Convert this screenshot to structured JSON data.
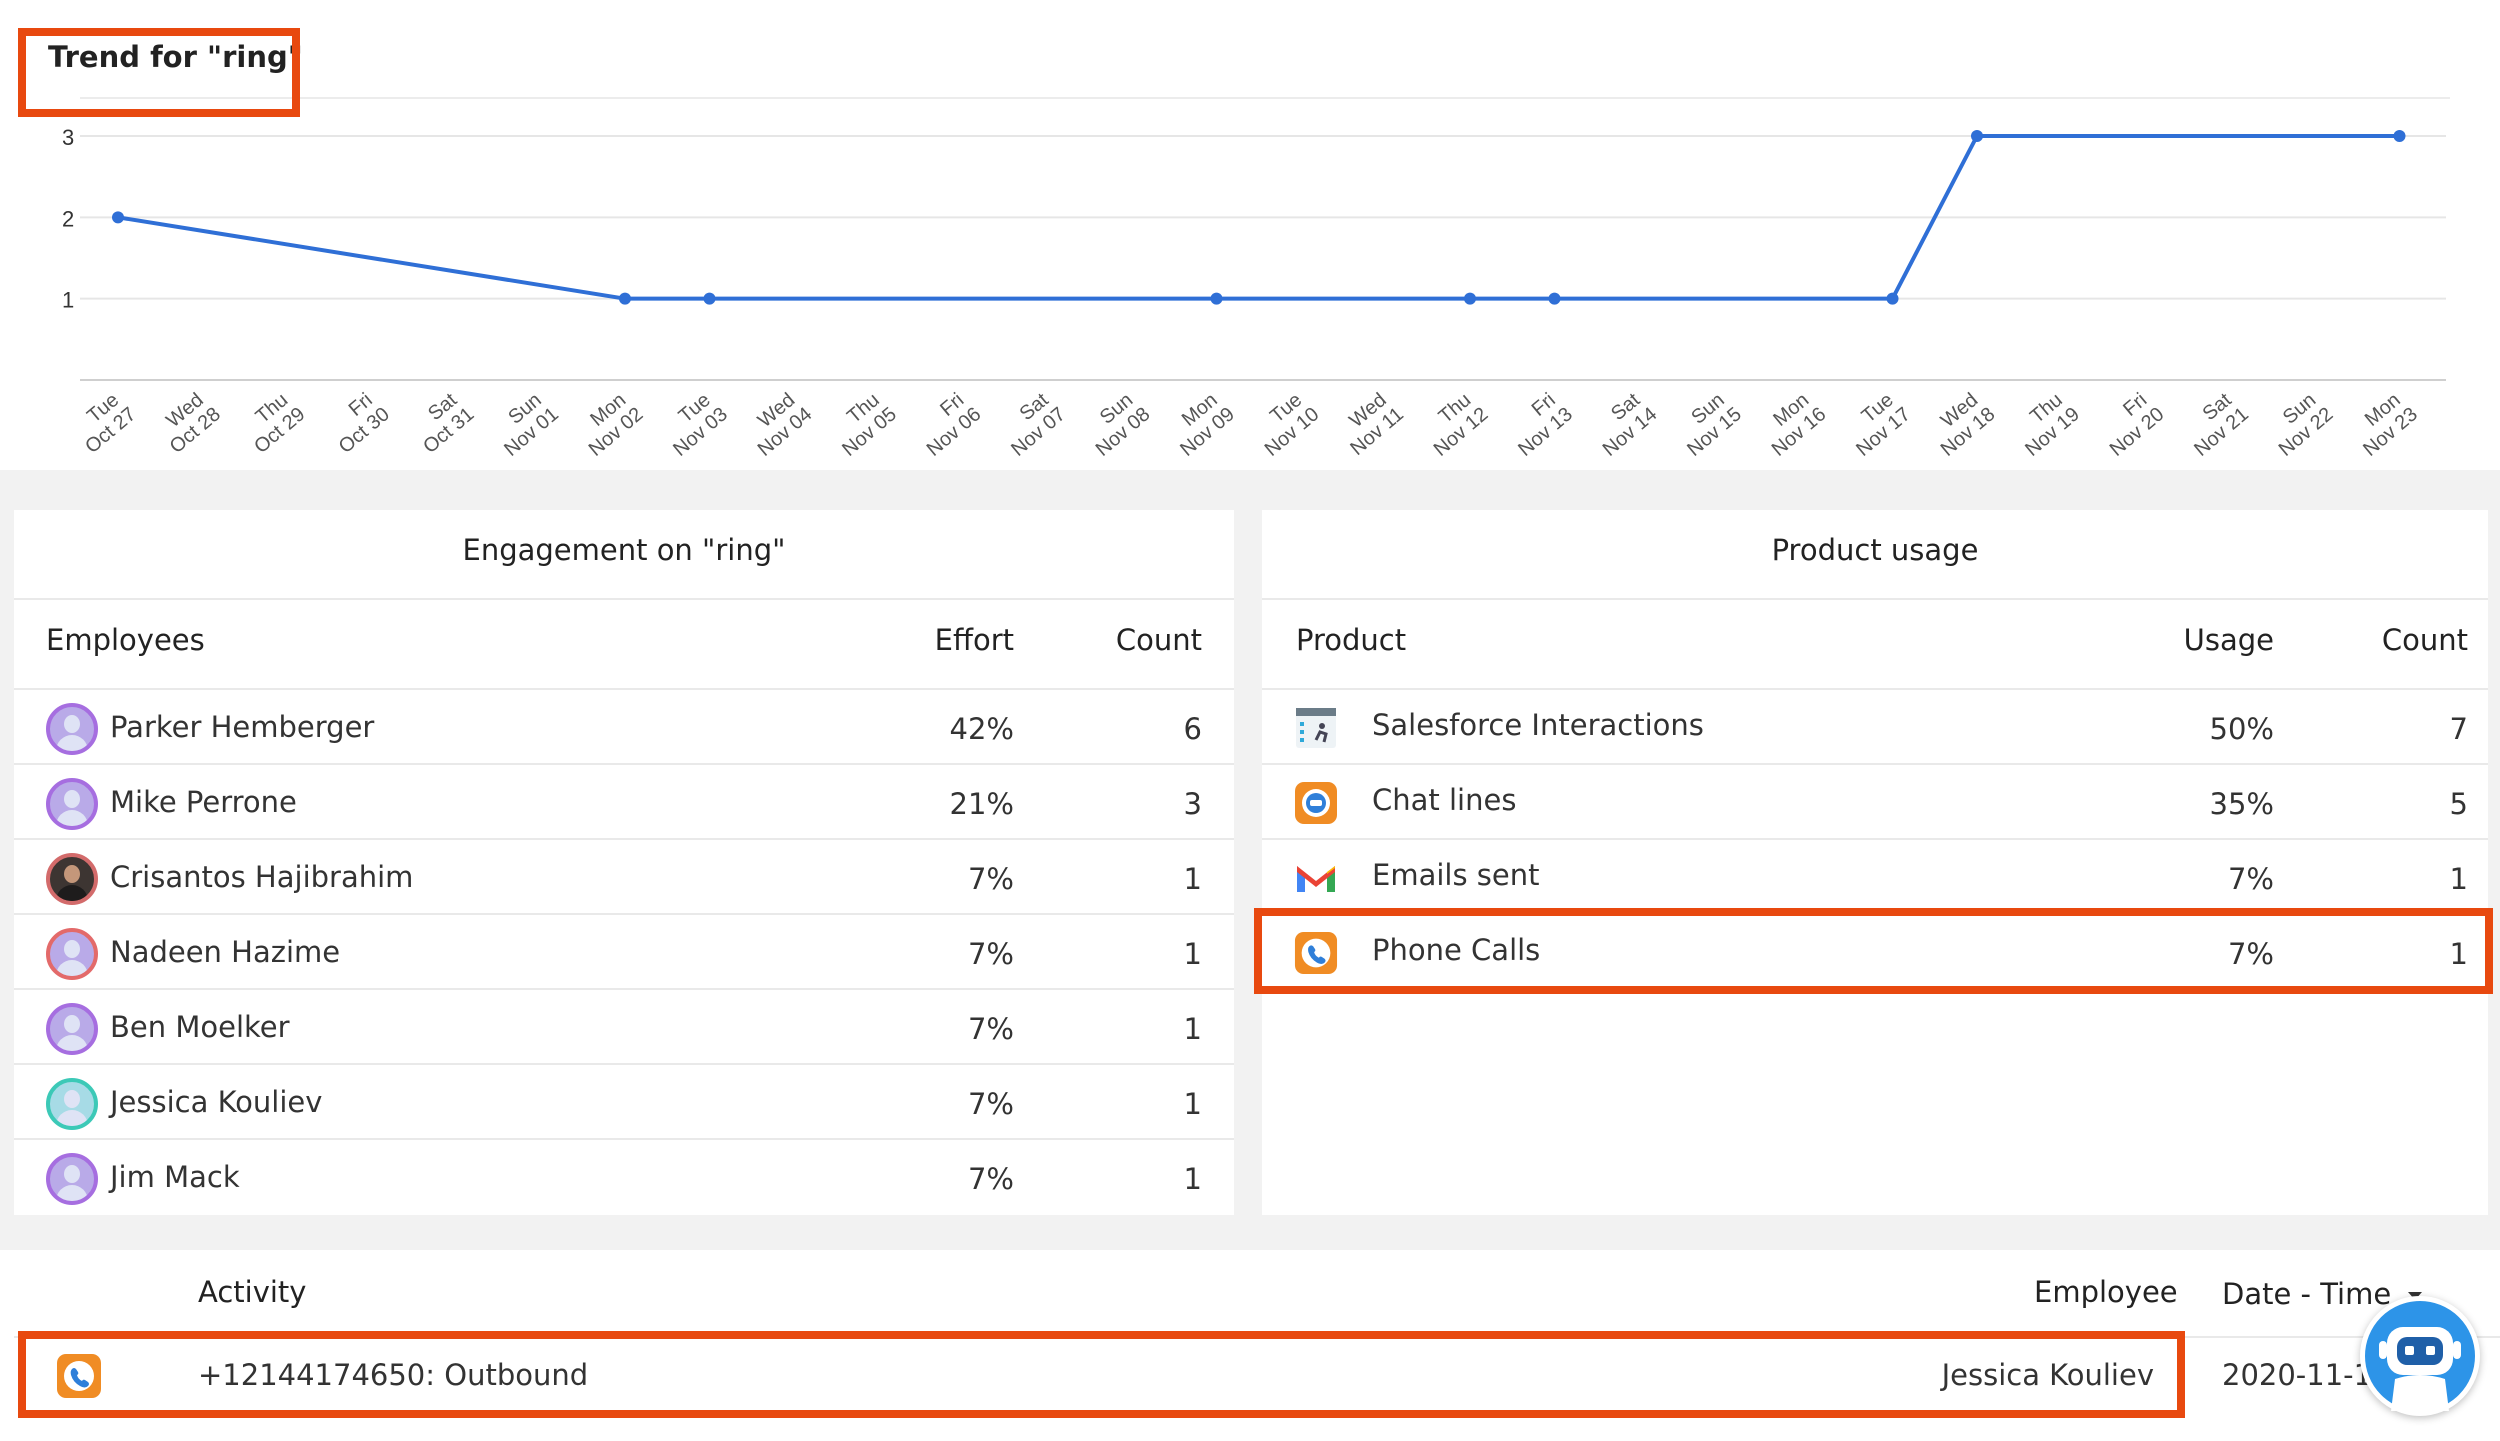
{
  "trend": {
    "title": "Trend for \"ring\"",
    "y_ticks": [
      "3",
      "2",
      "1"
    ],
    "x_labels": [
      [
        "Tue",
        "Oct 27"
      ],
      [
        "Wed",
        "Oct 28"
      ],
      [
        "Thu",
        "Oct 29"
      ],
      [
        "Fri",
        "Oct 30"
      ],
      [
        "Sat",
        "Oct 31"
      ],
      [
        "Sun",
        "Nov 01"
      ],
      [
        "Mon",
        "Nov 02"
      ],
      [
        "Tue",
        "Nov 03"
      ],
      [
        "Wed",
        "Nov 04"
      ],
      [
        "Thu",
        "Nov 05"
      ],
      [
        "Fri",
        "Nov 06"
      ],
      [
        "Sat",
        "Nov 07"
      ],
      [
        "Sun",
        "Nov 08"
      ],
      [
        "Mon",
        "Nov 09"
      ],
      [
        "Tue",
        "Nov 10"
      ],
      [
        "Wed",
        "Nov 11"
      ],
      [
        "Thu",
        "Nov 12"
      ],
      [
        "Fri",
        "Nov 13"
      ],
      [
        "Sat",
        "Nov 14"
      ],
      [
        "Sun",
        "Nov 15"
      ],
      [
        "Mon",
        "Nov 16"
      ],
      [
        "Tue",
        "Nov 17"
      ],
      [
        "Wed",
        "Nov 18"
      ],
      [
        "Thu",
        "Nov 19"
      ],
      [
        "Fri",
        "Nov 20"
      ],
      [
        "Sat",
        "Nov 21"
      ],
      [
        "Sun",
        "Nov 22"
      ],
      [
        "Mon",
        "Nov 23"
      ]
    ],
    "chart_data": {
      "type": "line",
      "x": [
        "Oct 27",
        "Nov 02",
        "Nov 03",
        "Nov 09",
        "Nov 12",
        "Nov 13",
        "Nov 17",
        "Nov 18",
        "Nov 23"
      ],
      "values": [
        2,
        1,
        1,
        1,
        1,
        1,
        1,
        3,
        3
      ],
      "ylim": [
        0,
        3
      ],
      "grid": true,
      "line_color": "#2f6fd6"
    }
  },
  "engagement": {
    "title": "Engagement on \"ring\"",
    "headers": {
      "employees": "Employees",
      "effort": "Effort",
      "count": "Count"
    },
    "rows": [
      {
        "name": "Parker Hemberger",
        "effort": "42%",
        "count": "6"
      },
      {
        "name": "Mike Perrone",
        "effort": "21%",
        "count": "3"
      },
      {
        "name": "Crisantos Hajibrahim",
        "effort": "7%",
        "count": "1"
      },
      {
        "name": "Nadeen Hazime",
        "effort": "7%",
        "count": "1"
      },
      {
        "name": "Ben Moelker",
        "effort": "7%",
        "count": "1"
      },
      {
        "name": "Jessica Kouliev",
        "effort": "7%",
        "count": "1"
      },
      {
        "name": "Jim Mack",
        "effort": "7%",
        "count": "1"
      }
    ]
  },
  "product_usage": {
    "title": "Product usage",
    "headers": {
      "product": "Product",
      "usage": "Usage",
      "count": "Count"
    },
    "rows": [
      {
        "name": "Salesforce Interactions",
        "usage": "50%",
        "count": "7",
        "icon": "salesforce-icon"
      },
      {
        "name": "Chat lines",
        "usage": "35%",
        "count": "5",
        "icon": "chat-icon"
      },
      {
        "name": "Emails sent",
        "usage": "7%",
        "count": "1",
        "icon": "gmail-icon"
      },
      {
        "name": "Phone Calls",
        "usage": "7%",
        "count": "1",
        "icon": "phone-icon"
      }
    ]
  },
  "activity": {
    "headers": {
      "activity": "Activity",
      "employee": "Employee",
      "datetime": "Date - Time"
    },
    "rows": [
      {
        "activity": "+12144174650: Outbound",
        "employee": "Jessica Kouliev",
        "datetime": "2020-11-13",
        "icon": "phone-icon"
      }
    ]
  },
  "colors": {
    "highlight": "#e8490f",
    "line": "#2f6fd6",
    "assistant": "#2d94e8"
  }
}
